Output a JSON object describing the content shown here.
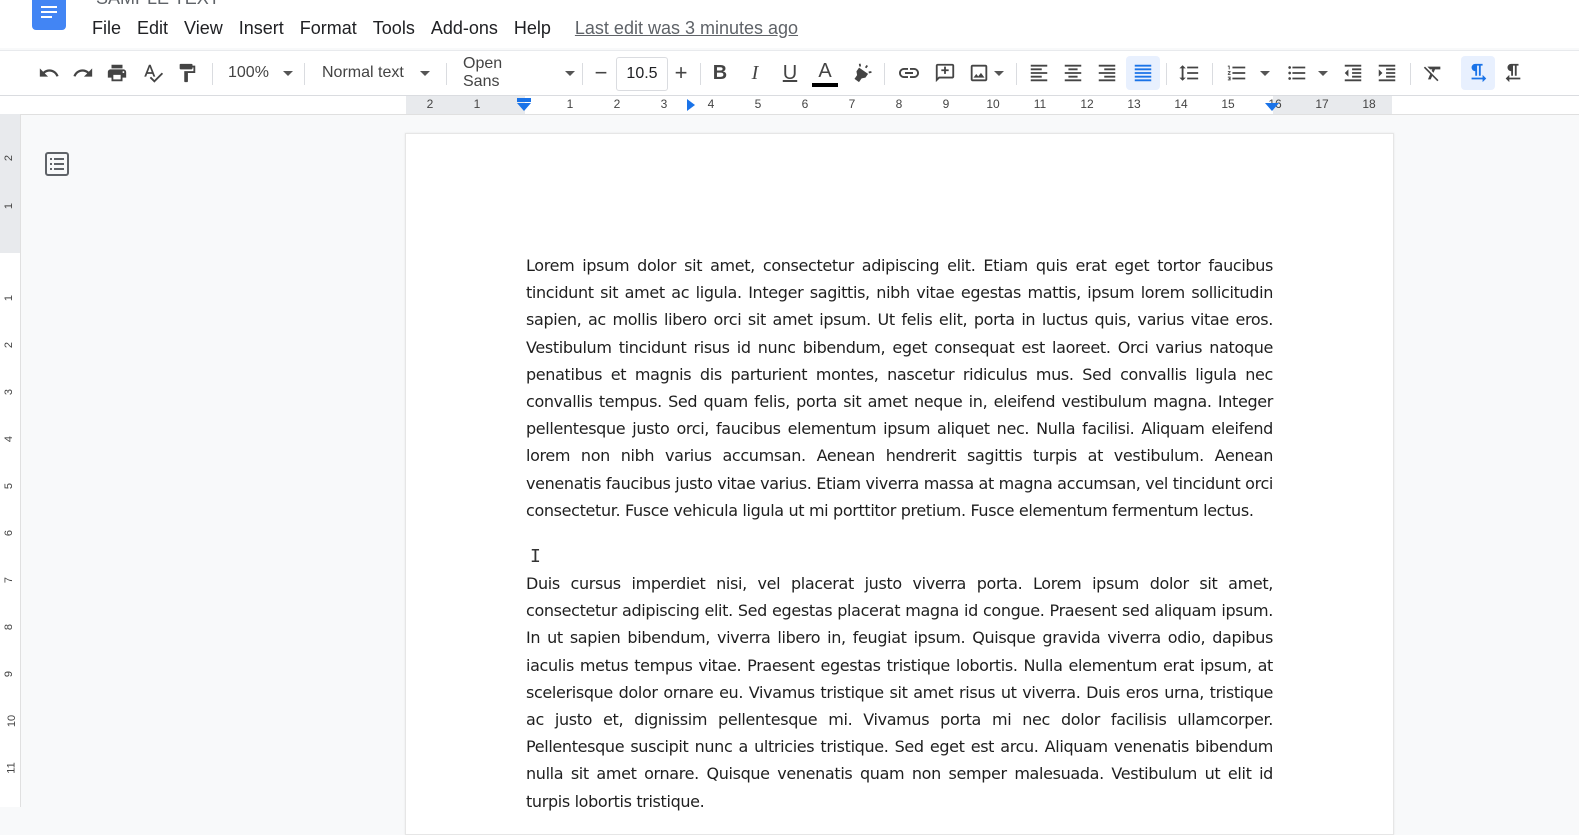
{
  "app": {
    "title_partial": "SAMPLE TEXT",
    "menu": [
      "File",
      "Edit",
      "View",
      "Insert",
      "Format",
      "Tools",
      "Add-ons",
      "Help"
    ],
    "last_edit": "Last edit was 3 minutes ago"
  },
  "toolbar": {
    "zoom": "100%",
    "style": "Normal text",
    "font": "Open Sans",
    "font_size": "10.5",
    "decrease_label": "−",
    "increase_label": "+",
    "bold": "B",
    "italic": "I",
    "underline": "U",
    "text_color_label": "A",
    "accent": "#1a73e8"
  },
  "ruler": {
    "horizontal_numbers": [
      "2",
      "1",
      "1",
      "2",
      "3",
      "4",
      "5",
      "6",
      "7",
      "8",
      "9",
      "10",
      "11",
      "12",
      "13",
      "14",
      "15",
      "16",
      "17",
      "18"
    ],
    "vertical_numbers": [
      "2",
      "1",
      "1",
      "2",
      "3",
      "4",
      "5",
      "6",
      "7",
      "8",
      "9",
      "10",
      "11"
    ]
  },
  "document": {
    "paragraphs": [
      "Lorem ipsum dolor sit amet, consectetur adipiscing elit. Etiam quis erat eget tortor faucibus tincidunt sit amet ac ligula. Integer sagittis, nibh vitae egestas mattis, ipsum lorem sollicitudin sapien, ac mollis libero orci sit amet ipsum. Ut felis elit, porta in luctus quis, varius vitae eros. Vestibulum tincidunt risus id nunc bibendum, eget consequat est laoreet. Orci varius natoque penatibus et magnis dis parturient montes, nascetur ridiculus mus. Sed convallis ligula nec convallis tempus. Sed quam felis, porta sit amet neque in, eleifend vestibulum magna. Integer pellentesque justo orci, faucibus elementum ipsum aliquet nec. Nulla facilisi. Aliquam eleifend lorem non nibh varius accumsan. Aenean hendrerit sagittis turpis at vestibulum. Aenean venenatis faucibus justo vitae varius. Etiam viverra massa at magna accumsan, vel tincidunt orci consectetur. Fusce vehicula ligula ut mi porttitor pretium. Fusce elementum fermentum lectus.",
      "Duis cursus imperdiet nisi, vel placerat justo viverra porta. Lorem ipsum dolor sit amet, consectetur adipiscing elit. Sed egestas placerat magna id congue. Praesent sed aliquam ipsum. In ut sapien bibendum, viverra libero in, feugiat ipsum. Quisque gravida viverra odio, dapibus iaculis metus tempus vitae. Praesent egestas tristique lobortis. Nulla elementum erat ipsum, at scelerisque dolor ornare eu. Vivamus tristique sit amet risus ut viverra. Duis eros urna, tristique ac justo et, dignissim pellentesque mi. Vivamus porta mi nec dolor facilisis ullamcorper. Pellentesque suscipit nunc a ultricies tristique. Sed eget est arcu. Aliquam venenatis bibendum nulla sit amet ornare. Quisque venenatis quam non semper malesuada. Vestibulum ut elit id turpis lobortis tristique."
    ]
  }
}
